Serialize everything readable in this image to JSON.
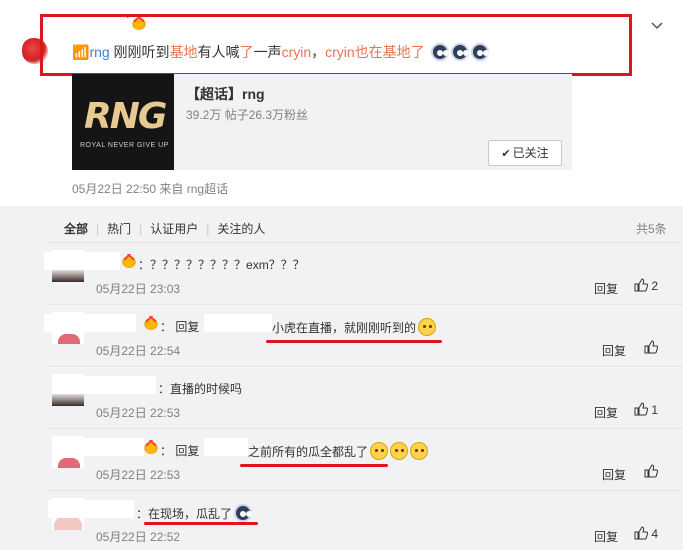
{
  "post": {
    "text_parts": [
      "rng",
      " 刚刚听到",
      "基地",
      "有人喊",
      "了",
      "一声",
      "cryin",
      "，",
      "cryin也在基地了"
    ],
    "card": {
      "logo_text": "RNG",
      "logo_tagline": "ROYAL NEVER GIVE UP",
      "title": "【超话】rng",
      "stats": "39.2万 帖子26.3万粉丝",
      "follow_label": "已关注"
    },
    "meta": "05月22日 22:50  来自 rng超话"
  },
  "tabs": [
    "全部",
    "热门",
    "认证用户",
    "关注的人"
  ],
  "total_count": "共5条",
  "comments": [
    {
      "prefix": "：",
      "body": "？？？？？？？？exm？？？",
      "time": "05月22日 23:03",
      "reply": "回复",
      "likes": "2"
    },
    {
      "prefix": "：",
      "reply_word": "回复",
      "body": "小虎在直播，就刚刚听到的",
      "time": "05月22日 22:54",
      "reply": "回复",
      "likes": ""
    },
    {
      "prefix": "：",
      "body": "直播的时候吗",
      "time": "05月22日 22:53",
      "reply": "回复",
      "likes": "1"
    },
    {
      "prefix": "：",
      "reply_word": "回复",
      "body": "之前所有的瓜全都乱了",
      "time": "05月22日 22:53",
      "reply": "回复",
      "likes": ""
    },
    {
      "prefix": "：",
      "body": "在现场，瓜乱了",
      "time": "05月22日 22:52",
      "reply": "回复",
      "likes": "4"
    }
  ],
  "colors": {
    "highlight_box": "#e0141e",
    "link": "#eb7350",
    "topic_link": "#3c7fd6",
    "meta": "#808080"
  },
  "icons": [
    "chevron-down-icon",
    "crown-badge-icon",
    "doge-emoji-icon",
    "yellow-face-emoji-icon",
    "thumb-up-icon",
    "check-icon",
    "supertopic-link-icon"
  ]
}
